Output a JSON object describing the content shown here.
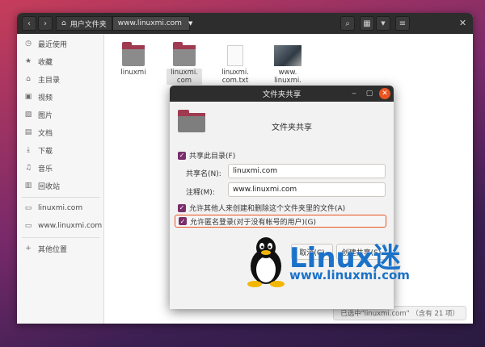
{
  "window": {
    "path": [
      "用户文件夹",
      "www.linuxmi.com"
    ],
    "status": "已选中\"linuxmi.com\" （含有 21 项）"
  },
  "sidebar": {
    "items": [
      {
        "icon": "clock-icon",
        "label": "最近使用"
      },
      {
        "icon": "star-icon",
        "label": "收藏"
      },
      {
        "icon": "home-icon",
        "label": "主目录"
      },
      {
        "icon": "video-icon",
        "label": "视频"
      },
      {
        "icon": "picture-icon",
        "label": "图片"
      },
      {
        "icon": "document-icon",
        "label": "文档"
      },
      {
        "icon": "download-icon",
        "label": "下载"
      },
      {
        "icon": "music-icon",
        "label": "音乐"
      },
      {
        "icon": "trash-icon",
        "label": "回收站"
      }
    ],
    "bookmarks": [
      {
        "icon": "folder-icon",
        "label": "linuxmi.com"
      },
      {
        "icon": "folder-icon",
        "label": "www.linuxmi.com"
      }
    ],
    "other": {
      "icon": "plus-icon",
      "label": "其他位置"
    }
  },
  "files": [
    {
      "type": "folder",
      "label1": "linuxmi",
      "label2": ""
    },
    {
      "type": "folder",
      "label1": "linuxmi.",
      "label2": "com"
    },
    {
      "type": "text",
      "label1": "linuxmi.",
      "label2": "com.txt"
    },
    {
      "type": "image",
      "label1": "www.",
      "label2": "linuxmi."
    }
  ],
  "dialog": {
    "title": "文件夹共享",
    "heading": "文件夹共享",
    "share_folder": "共享此目录(F)",
    "share_name_label": "共享名(N):",
    "share_name_value": "linuxmi.com",
    "comment_label": "注释(M):",
    "comment_value": "www.linuxmi.com",
    "allow_others": "允许其他人来创建和删除这个文件夹里的文件(A)",
    "guest_access": "允许匿名登录(对于没有帐号的用户)(G)",
    "cancel": "取消(C)",
    "create": "创建共享(S)"
  },
  "watermark": {
    "brand": "Linux迷",
    "url": "www.linuxmi.com"
  },
  "colors": {
    "accent": "#e95420",
    "checkbox": "#7a2e6a",
    "folder_tab": "#a03a50",
    "brand_blue": "#1a72c9"
  }
}
